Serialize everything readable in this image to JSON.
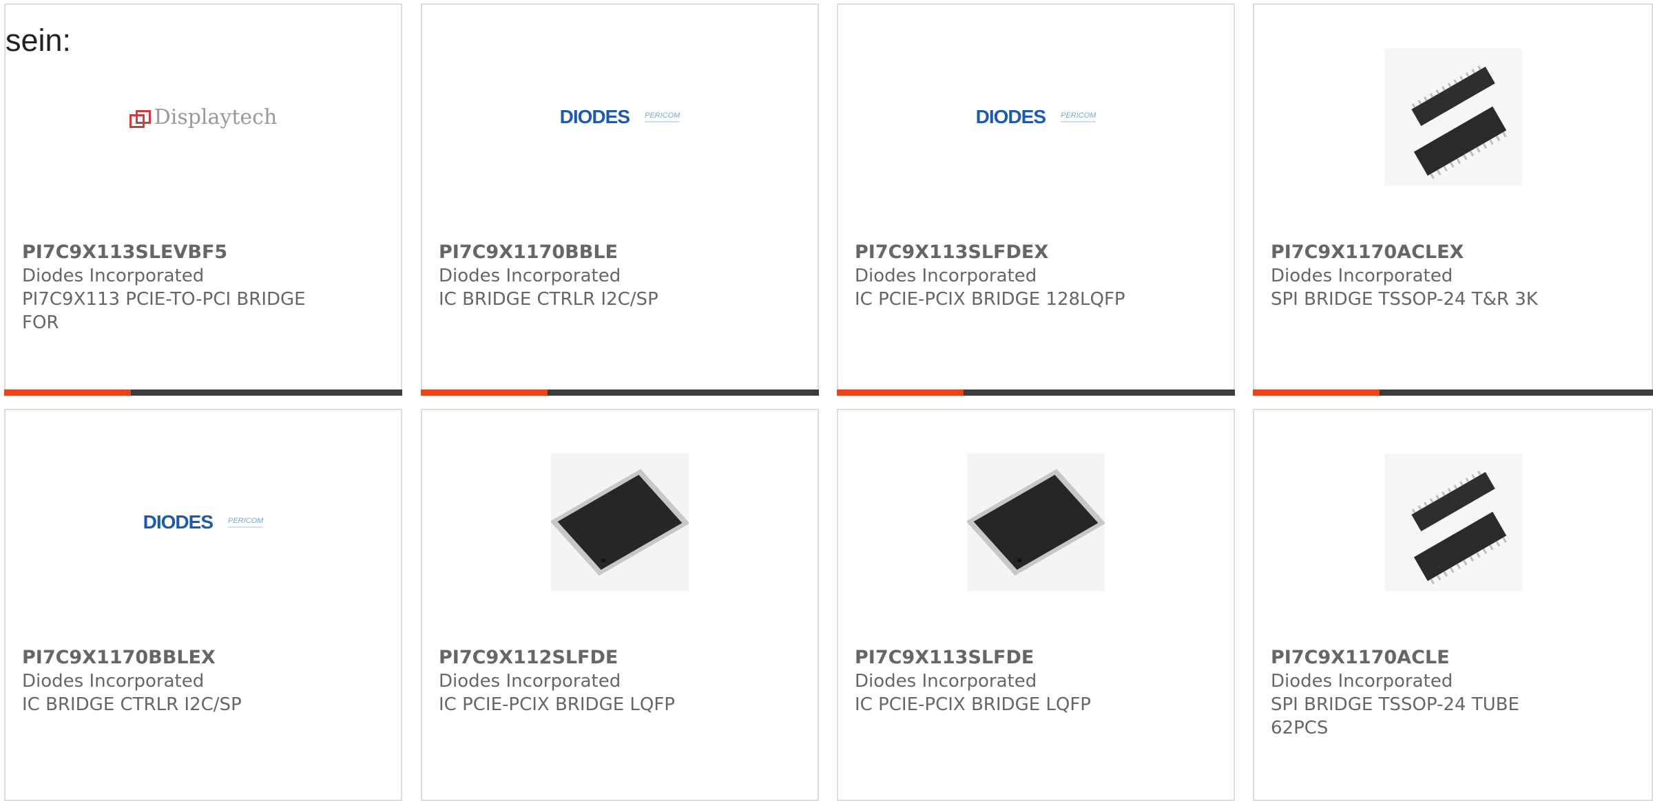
{
  "intro_text": "sein:",
  "cards": [
    {
      "part": "PI7C9X113SLEVBF5",
      "mfr": "Diodes Incorporated",
      "desc": "PI7C9X113 PCIE-TO-PCI BRIDGE FOR",
      "image": "displaytech-logo",
      "logo_text": "Displaytech"
    },
    {
      "part": "PI7C9X1170BBLE",
      "mfr": "Diodes Incorporated",
      "desc": "IC BRIDGE CTRLR I2C/SP",
      "image": "diodes-pericom-logo",
      "logo_text": "DIODES",
      "logo_sub": "PERICOM"
    },
    {
      "part": "PI7C9X113SLFDEX",
      "mfr": "Diodes Incorporated",
      "desc": "IC PCIE-PCIX BRIDGE 128LQFP",
      "image": "diodes-pericom-logo",
      "logo_text": "DIODES",
      "logo_sub": "PERICOM"
    },
    {
      "part": "PI7C9X1170ACLEX",
      "mfr": "Diodes Incorporated",
      "desc": "SPI BRIDGE TSSOP-24 T&R 3K",
      "image": "tssop-chip-photo"
    },
    {
      "part": "PI7C9X1170BBLEX",
      "mfr": "Diodes Incorporated",
      "desc": "IC BRIDGE CTRLR I2C/SP",
      "image": "diodes-pericom-logo",
      "logo_text": "DIODES",
      "logo_sub": "PERICOM"
    },
    {
      "part": "PI7C9X112SLFDE",
      "mfr": "Diodes Incorporated",
      "desc": "IC PCIE-PCIX BRIDGE LQFP",
      "image": "lqfp-chip-photo"
    },
    {
      "part": "PI7C9X113SLFDE",
      "mfr": "Diodes Incorporated",
      "desc": "IC PCIE-PCIX BRIDGE LQFP",
      "image": "lqfp-chip-photo"
    },
    {
      "part": "PI7C9X1170ACLE",
      "mfr": "Diodes Incorporated",
      "desc": "SPI BRIDGE TSSOP-24 TUBE 62PCS",
      "image": "tssop-chip-photo"
    }
  ],
  "colors": {
    "accent": "#e8431b",
    "bar": "#3c3c3c",
    "border": "#dddddd",
    "text": "#666666",
    "diodes_blue": "#1d5aa8"
  }
}
